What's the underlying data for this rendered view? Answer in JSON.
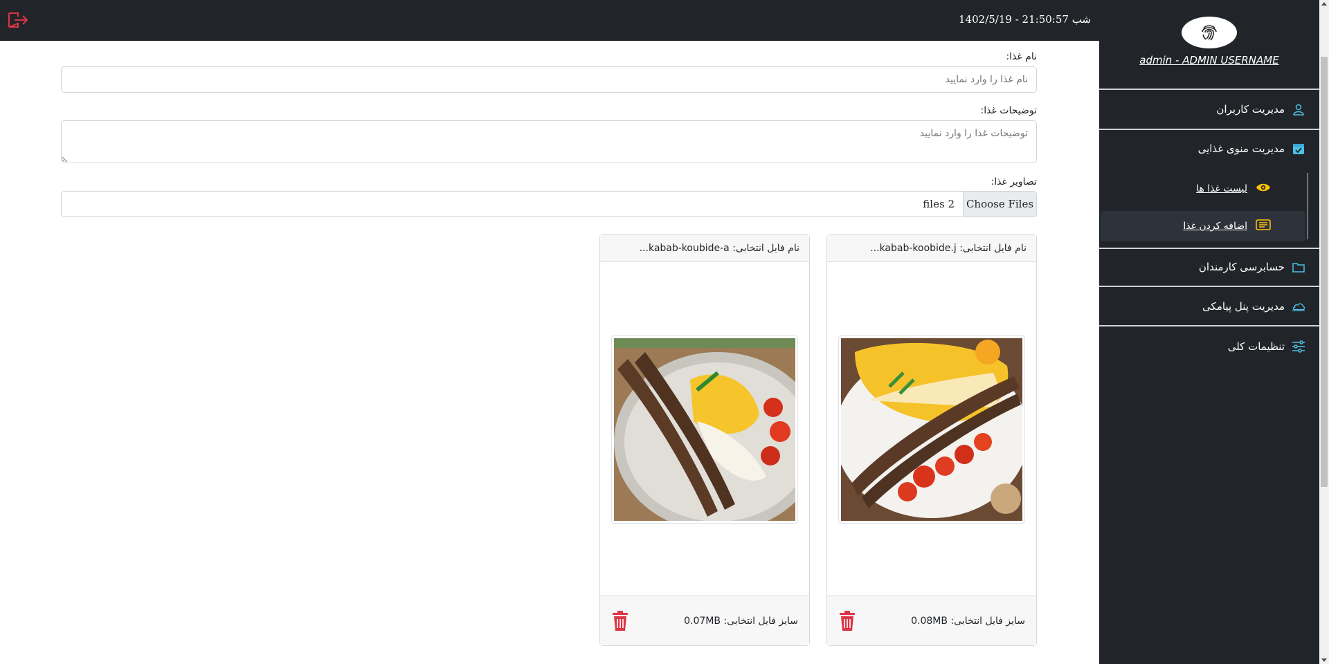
{
  "topbar": {
    "datetime": "شب 21:50:57 - 1402/5/19",
    "logout_icon": "logout-icon"
  },
  "sidebar": {
    "username": "admin - ADMIN USERNAME",
    "items": [
      {
        "label": "مدیریت کاربران",
        "icon": "user-icon"
      },
      {
        "label": "مدیریت منوی غذایی",
        "icon": "calendar-check-icon"
      },
      {
        "label": "حسابرسی کارمندان",
        "icon": "folder-icon"
      },
      {
        "label": "مدیریت پنل پیامکی",
        "icon": "cloud-icon"
      },
      {
        "label": "تنظیمات کلی",
        "icon": "sliders-icon"
      }
    ],
    "subitems": [
      {
        "label": "لیست غذا ها",
        "icon": "eye-icon"
      },
      {
        "label": "اضافه کردن غذا",
        "icon": "card-text-icon"
      }
    ]
  },
  "form": {
    "name_label": "نام غذا:",
    "name_placeholder": "نام غذا را وارد نمایید",
    "desc_label": "توضیحات غذا:",
    "desc_placeholder": "توضیحات غذا را وارد نمایید",
    "images_label": "تصاویر غذا:",
    "choose_files_label": "Choose Files",
    "files_chosen": "2 files"
  },
  "cards": [
    {
      "filename": "نام فایل انتخابی: kabab-koobide.j...",
      "size": "سایز فایل انتخابی: 0.08MB"
    },
    {
      "filename": "نام فایل انتخابی: kabab-koubide-a...",
      "size": "سایز فایل انتخابی: 0.07MB"
    }
  ],
  "colors": {
    "dark": "#212529",
    "accent": "#4dc0e8",
    "danger": "#dc3545",
    "warning": "#ffc107"
  }
}
